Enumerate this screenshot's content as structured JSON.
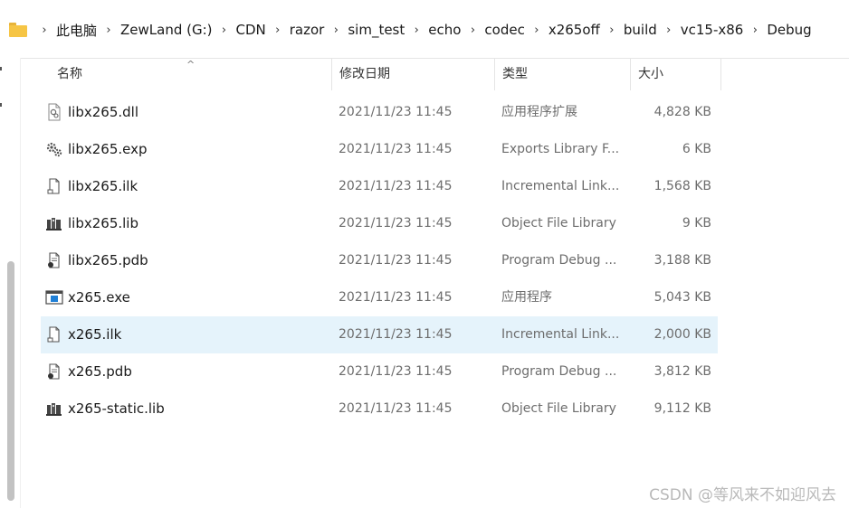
{
  "breadcrumb": {
    "items": [
      "此电脑",
      "ZewLand (G:)",
      "CDN",
      "razor",
      "sim_test",
      "echo",
      "codec",
      "x265off",
      "build",
      "vc15-x86",
      "Debug"
    ]
  },
  "columns": {
    "name": "名称",
    "date": "修改日期",
    "type": "类型",
    "size": "大小"
  },
  "files": [
    {
      "name": "libx265.dll",
      "date": "2021/11/23 11:45",
      "type": "应用程序扩展",
      "size": "4,828 KB",
      "icon": "dll-file-icon"
    },
    {
      "name": "libx265.exp",
      "date": "2021/11/23 11:45",
      "type": "Exports Library F...",
      "size": "6 KB",
      "icon": "exp-file-icon"
    },
    {
      "name": "libx265.ilk",
      "date": "2021/11/23 11:45",
      "type": "Incremental Link...",
      "size": "1,568 KB",
      "icon": "ilk-file-icon"
    },
    {
      "name": "libx265.lib",
      "date": "2021/11/23 11:45",
      "type": "Object File Library",
      "size": "9 KB",
      "icon": "lib-file-icon"
    },
    {
      "name": "libx265.pdb",
      "date": "2021/11/23 11:45",
      "type": "Program Debug ...",
      "size": "3,188 KB",
      "icon": "pdb-file-icon"
    },
    {
      "name": "x265.exe",
      "date": "2021/11/23 11:45",
      "type": "应用程序",
      "size": "5,043 KB",
      "icon": "exe-file-icon"
    },
    {
      "name": "x265.ilk",
      "date": "2021/11/23 11:45",
      "type": "Incremental Link...",
      "size": "2,000 KB",
      "icon": "ilk-file-icon",
      "selected": true
    },
    {
      "name": "x265.pdb",
      "date": "2021/11/23 11:45",
      "type": "Program Debug ...",
      "size": "3,812 KB",
      "icon": "pdb-file-icon"
    },
    {
      "name": "x265-static.lib",
      "date": "2021/11/23 11:45",
      "type": "Object File Library",
      "size": "9,112 KB",
      "icon": "lib-file-icon"
    }
  ],
  "watermark": "CSDN @等风来不如迎风去",
  "colors": {
    "selection": "#e5f3fb",
    "folder": "#f6c545",
    "secondary_text": "#6d6d6d"
  }
}
